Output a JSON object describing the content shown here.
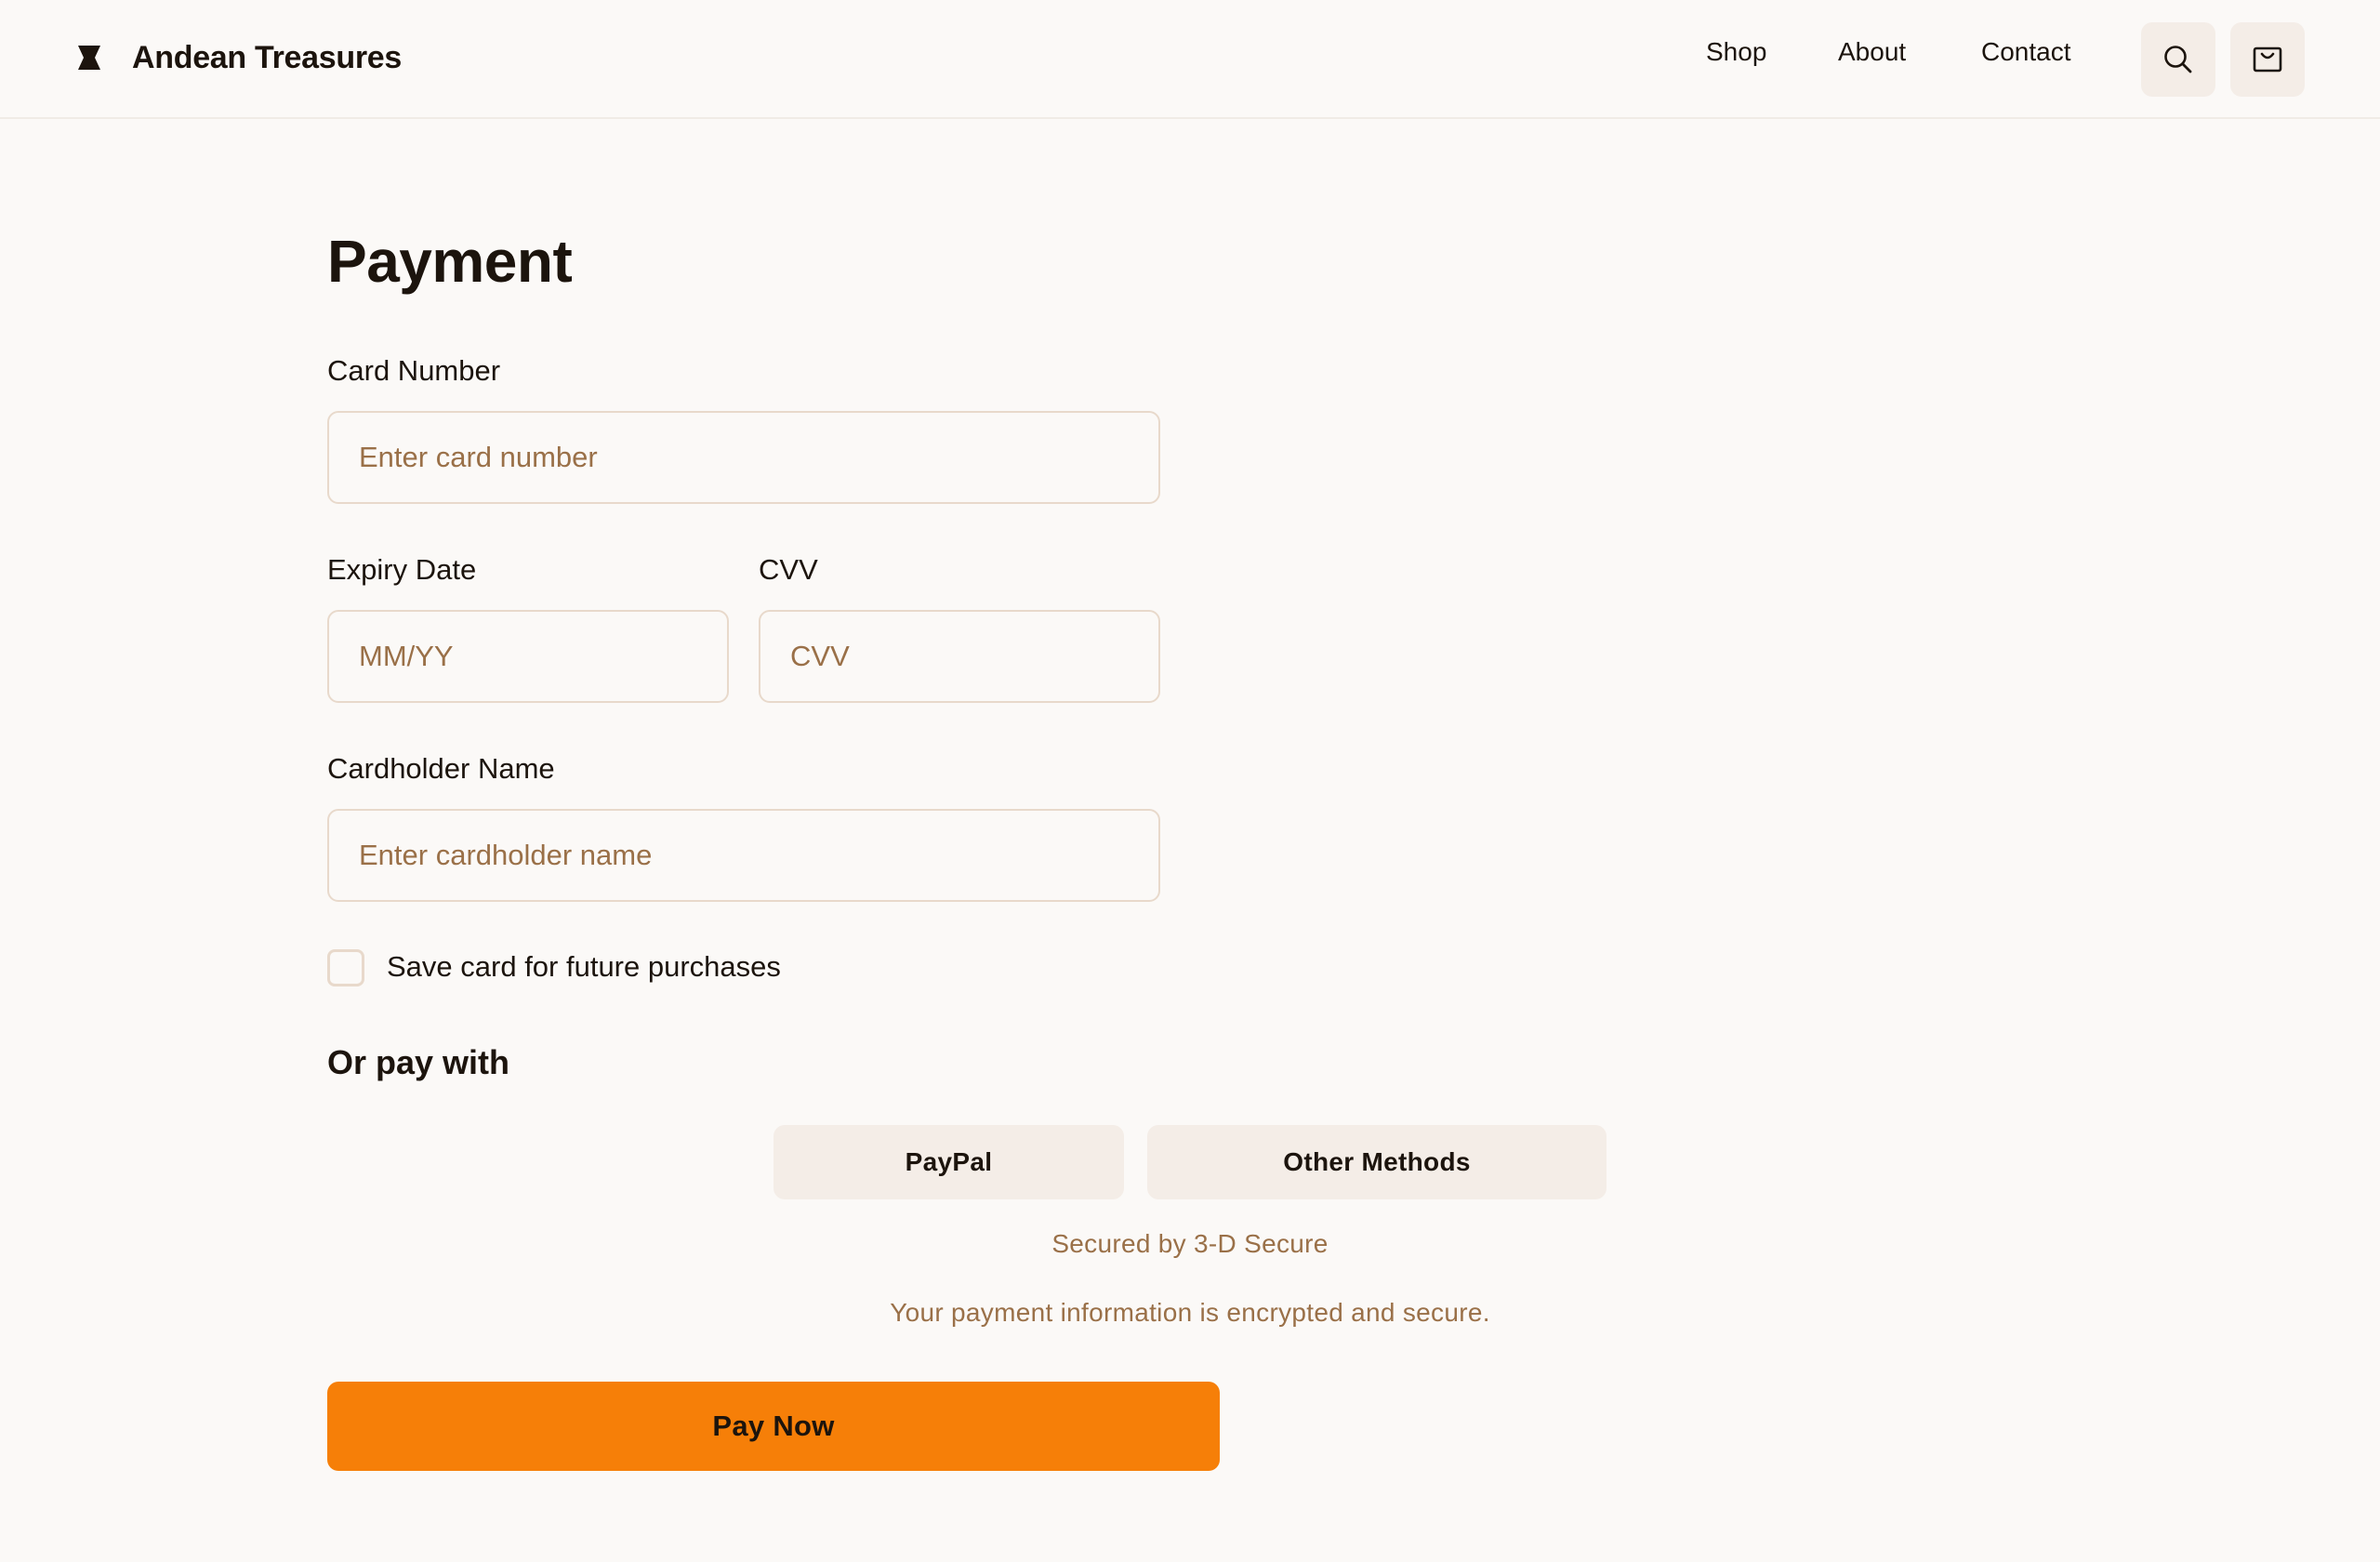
{
  "header": {
    "brand_name": "Andean Treasures",
    "brand_icon": "hourglass-logo-icon",
    "nav": [
      "Shop",
      "About",
      "Contact"
    ],
    "search_icon": "search-icon",
    "cart_icon": "shopping-bag-icon"
  },
  "payment": {
    "title": "Payment",
    "card_number": {
      "label": "Card Number",
      "placeholder": "Enter card number",
      "value": ""
    },
    "expiry": {
      "label": "Expiry Date",
      "placeholder": "MM/YY",
      "value": ""
    },
    "cvv": {
      "label": "CVV",
      "placeholder": "CVV",
      "value": ""
    },
    "cardholder": {
      "label": "Cardholder Name",
      "placeholder": "Enter cardholder name",
      "value": ""
    },
    "save_card": {
      "label": "Save card for future purchases",
      "checked": false
    },
    "alt_title": "Or pay with",
    "alt_methods": [
      "PayPal",
      "Other Methods"
    ],
    "secured_note": "Secured by 3-D Secure",
    "encryption_note": "Your payment information is encrypted and secure.",
    "pay_button": "Pay Now"
  },
  "colors": {
    "accent": "#f67f08",
    "background": "#fbf9f7",
    "button_surface": "#f4ede7",
    "field_border": "#e8d9cb",
    "muted_text": "#9a7048",
    "text": "#1c140d"
  }
}
